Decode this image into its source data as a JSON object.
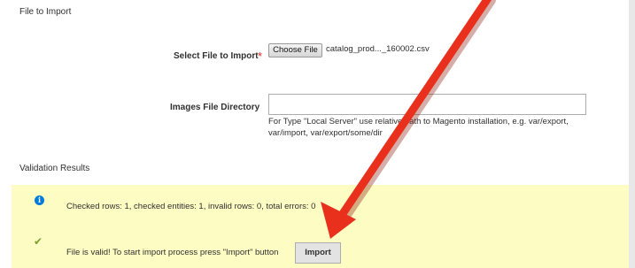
{
  "file_section": {
    "title": "File to Import"
  },
  "select_file": {
    "label": "Select File to Import",
    "required_mark": "*",
    "button_label": "Choose File",
    "file_name": "catalog_prod..._160002.csv"
  },
  "images_dir": {
    "label": "Images File Directory",
    "value": "",
    "note": "For Type \"Local Server\" use relative path to Magento installation, e.g. var/export, var/import, var/export/some/dir"
  },
  "validation": {
    "title": "Validation Results",
    "info_message": "Checked rows: 1, checked entities: 1, invalid rows: 0, total errors: 0",
    "success_message": "File is valid! To start import process press \"Import\" button",
    "import_button": "Import"
  },
  "colors": {
    "validation_background": "#fdfcc2",
    "info_icon": "#007bdb",
    "success_check": "#79a22e",
    "annotation_arrow": "#e8301c"
  }
}
